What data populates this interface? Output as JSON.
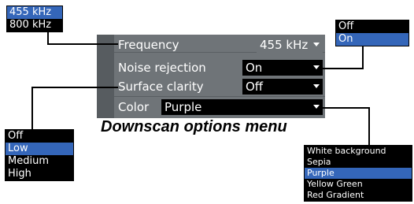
{
  "menu": {
    "caption": "Downscan options menu",
    "rows": [
      {
        "label": "Frequency",
        "value": "455 kHz"
      },
      {
        "label": "Noise rejection",
        "value": "On"
      },
      {
        "label": "Surface clarity",
        "value": "Off"
      },
      {
        "label": "Color",
        "value": "Purple"
      }
    ]
  },
  "popups": {
    "frequency": {
      "options": [
        "455 kHz",
        "800 kHz"
      ],
      "selected": "455 kHz"
    },
    "noise_rejection": {
      "options": [
        "Off",
        "On"
      ],
      "selected": "On"
    },
    "surface_clarity": {
      "options": [
        "Off",
        "Low",
        "Medium",
        "High"
      ],
      "selected": "Low"
    },
    "color": {
      "options": [
        "White background",
        "Sepia",
        "Purple",
        "Yellow Green",
        "Red Gradient"
      ],
      "selected": "Purple"
    }
  },
  "colors": {
    "highlight": "#3466b9",
    "menu_bg": "#6f7478"
  }
}
